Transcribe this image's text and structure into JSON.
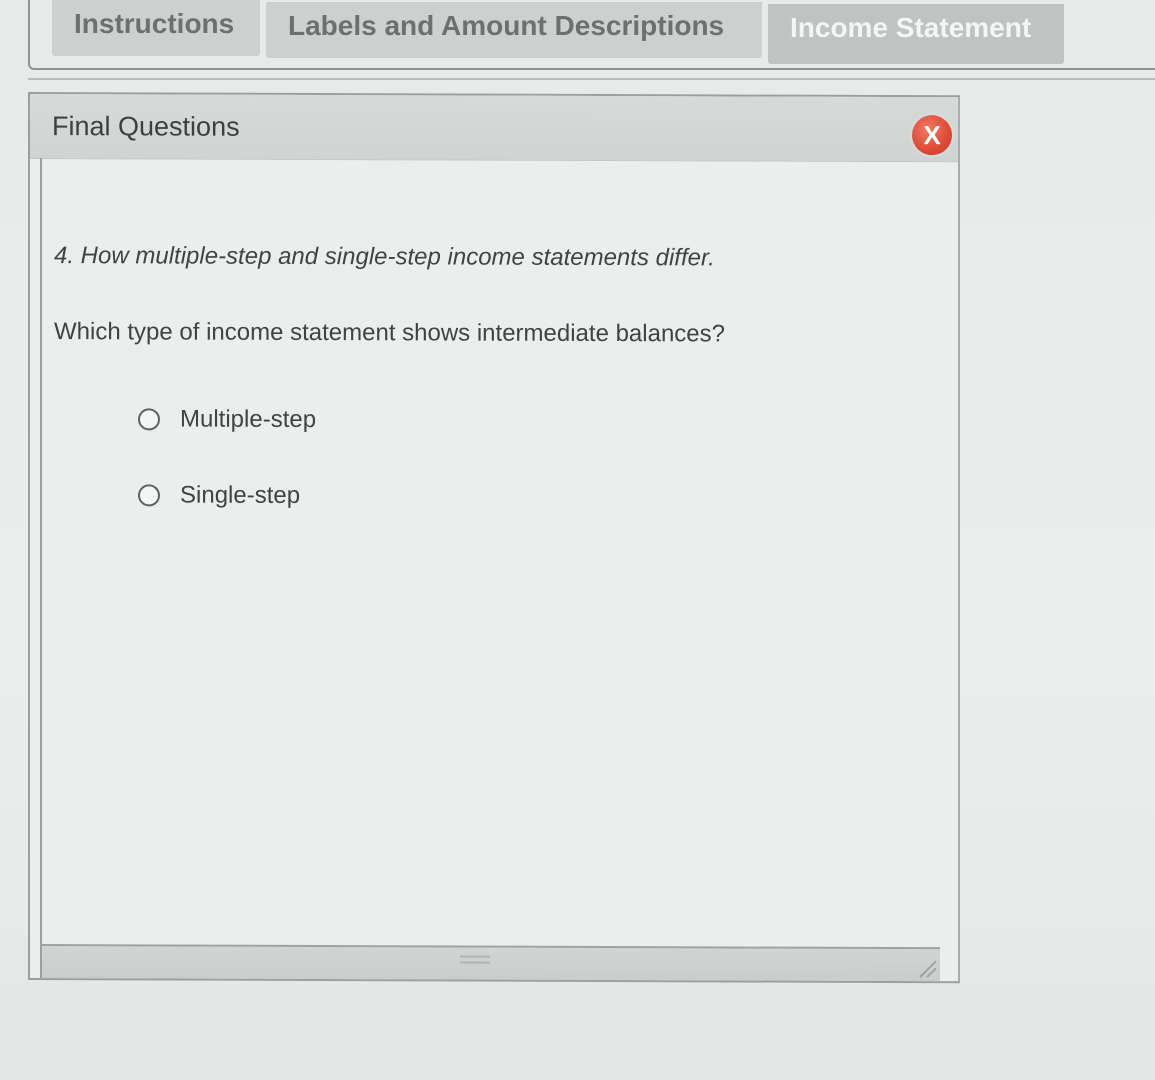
{
  "tabs": [
    {
      "label": "Instructions"
    },
    {
      "label": "Labels and Amount Descriptions"
    },
    {
      "label": "Income Statement"
    }
  ],
  "dialog": {
    "title": "Final Questions",
    "close_label": "X",
    "question_heading": "4. How multiple-step and single-step income statements differ.",
    "question_text": "Which type of income statement shows intermediate balances?",
    "options": [
      {
        "label": "Multiple-step",
        "selected": false
      },
      {
        "label": "Single-step",
        "selected": false
      }
    ]
  },
  "icons": {
    "close": "close-icon",
    "resize_grip": "resize-grip-icon",
    "corner_grip": "corner-resize-icon"
  },
  "colors": {
    "close_button": "#dd4a36",
    "tab_inactive": "#ccd0cf",
    "tab_active": "#bfc3c2"
  }
}
